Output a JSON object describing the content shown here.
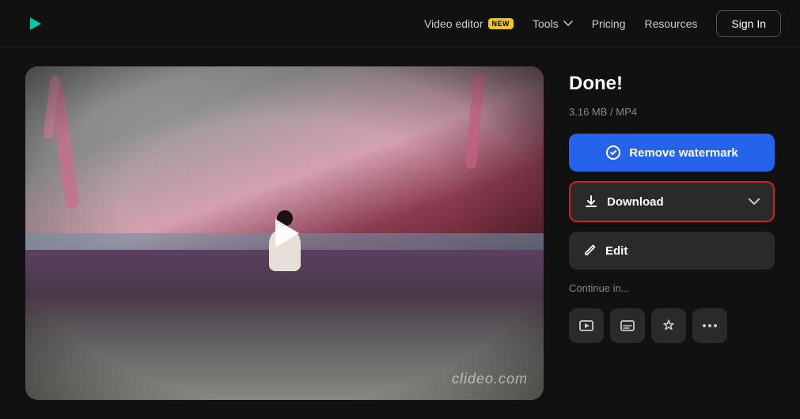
{
  "navbar": {
    "logo_alt": "Clideo logo",
    "video_editor_label": "Video editor",
    "new_badge": "NEW",
    "tools_label": "Tools",
    "pricing_label": "Pricing",
    "resources_label": "Resources",
    "sign_in_label": "Sign In"
  },
  "video": {
    "watermark": "clideo.com"
  },
  "sidebar": {
    "done_title": "Done!",
    "file_size": "3.16 MB",
    "file_format": "MP4",
    "remove_watermark_label": "Remove watermark",
    "download_label": "Download",
    "edit_label": "Edit",
    "continue_label": "Continue in..."
  }
}
